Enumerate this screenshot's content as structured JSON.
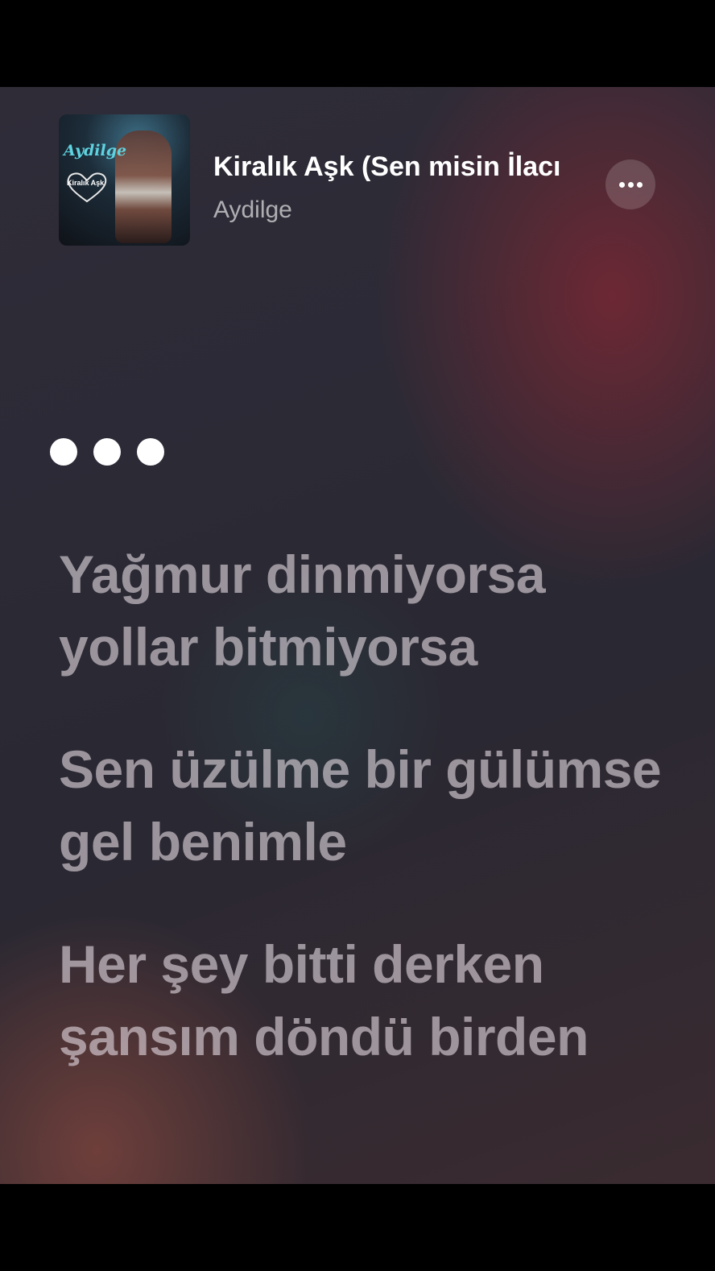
{
  "now_playing": {
    "album_art": {
      "artist_text": "Aydilge",
      "title_text": "Kiralık Aşk"
    },
    "song_title": "Kiralık Aşk (Sen misin İlacı",
    "artist": "Aydilge",
    "more_icon": "ellipsis-icon"
  },
  "instrumental_indicator_icon": "three-dots-icon",
  "lyrics": [
    "Yağmur dinmiyorsa yollar bitmiyorsa",
    "Sen üzülme bir gülümse gel benimle",
    "Her şey bitti derken şansım döndü birden"
  ],
  "colors": {
    "background": "#2b2a35",
    "accent_warm": "#782834",
    "lyric_text": "#e1d7de",
    "primary_text": "#ffffff"
  }
}
